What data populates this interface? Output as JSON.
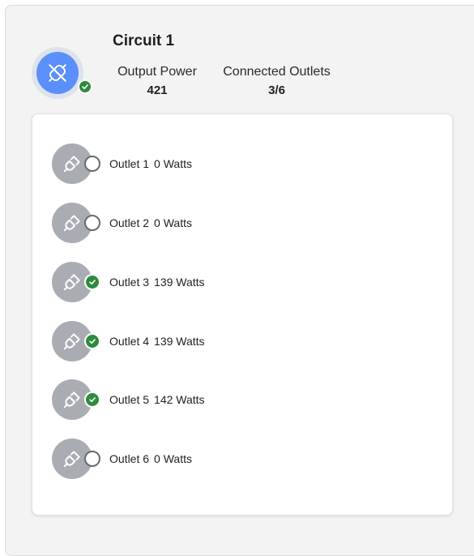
{
  "circuit": {
    "title": "Circuit 1",
    "icon": "plug-off-icon",
    "status": "connected",
    "output_power_label": "Output Power",
    "output_power_value": "421",
    "connected_outlets_label": "Connected Outlets",
    "connected_outlets_value": "3/6"
  },
  "colors": {
    "circuit_icon_bg": "#5b8ff9",
    "outlet_icon_bg": "#a9adb3",
    "connected_green": "#2e8b3d"
  },
  "outlets": [
    {
      "label": "Outlet 1",
      "watts": "0 Watts",
      "connected": false
    },
    {
      "label": "Outlet 2",
      "watts": "0 Watts",
      "connected": false
    },
    {
      "label": "Outlet 3",
      "watts": "139 Watts",
      "connected": true
    },
    {
      "label": "Outlet 4",
      "watts": "139 Watts",
      "connected": true
    },
    {
      "label": "Outlet 5",
      "watts": "142 Watts",
      "connected": true
    },
    {
      "label": "Outlet 6",
      "watts": "0 Watts",
      "connected": false
    }
  ]
}
